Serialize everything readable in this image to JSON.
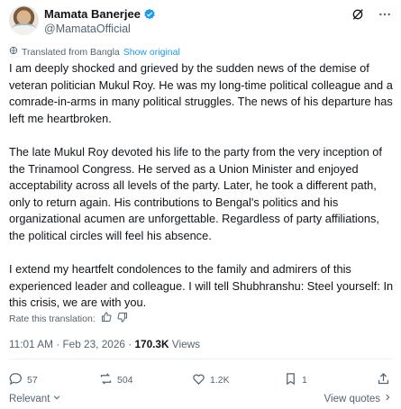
{
  "author": {
    "name": "Mamata Banerjee",
    "handle": "@MamataOfficial"
  },
  "translation": {
    "label": "Translated from Bangla",
    "show_original": "Show original"
  },
  "post": {
    "paragraphs": [
      "I am deeply shocked and grieved by the sudden news of the demise of veteran politician Mukul Roy. He was my long-time political colleague and a comrade-in-arms in many political struggles. The news of his departure has left me heartbroken.",
      "The late Mukul Roy devoted his life to the party from the very inception of the Trinamool Congress. He served as a Union Minister and enjoyed acceptability across all levels of the party. Later, he took a different path, only to return again. His contributions to Bengal's politics and his organizational acumen are unforgettable. Regardless of party affiliations, the political circles will feel his absence.",
      "I extend my heartfelt condolences to the family and admirers of this experienced leader and colleague. I will tell Shubhranshu: Steel yourself: In this crisis, we are with you."
    ]
  },
  "rate_translation": "Rate this translation:",
  "meta": {
    "timestamp": "11:01 AM · Feb 23, 2026 · ",
    "views_count": "170.3K",
    "views_label": " Views"
  },
  "actions": {
    "replies": "57",
    "reposts": "504",
    "likes": "1.2K",
    "bookmarks": "1"
  },
  "footer": {
    "sort_label": "Relevant",
    "view_quotes": "View quotes"
  },
  "colors": {
    "text": "#0f1419",
    "secondary": "#536471",
    "accent": "#1d9bf0",
    "divider": "#eff3f4"
  },
  "icons": {
    "verified": "verified-badge-icon",
    "grok": "grok-icon",
    "more": "more-icon",
    "translate": "translate-icon",
    "thumbs_up": "thumbs-up-icon",
    "thumbs_down": "thumbs-down-icon",
    "reply": "reply-icon",
    "repost": "repost-icon",
    "like": "heart-icon",
    "bookmark": "bookmark-icon",
    "share": "share-icon",
    "chevron": "chevron-down-icon"
  }
}
